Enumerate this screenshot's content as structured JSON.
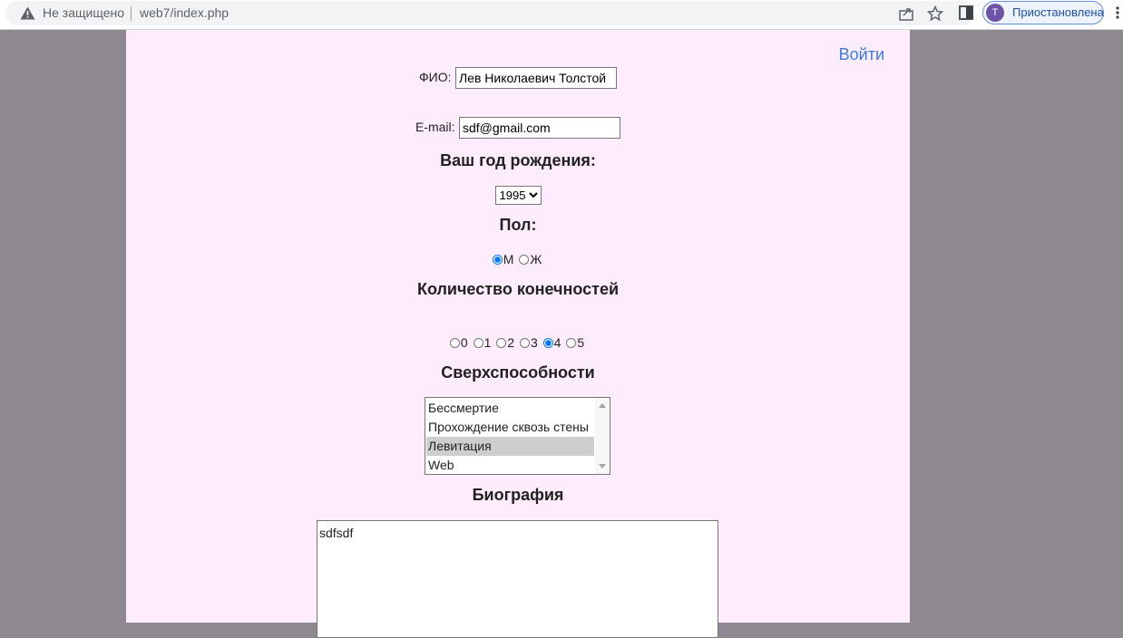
{
  "browser": {
    "security_label": "Не защищено",
    "url": "web7/index.php",
    "profile_initial": "T",
    "profile_status": "Приостановлена"
  },
  "page": {
    "login_link": "Войти",
    "fio_label": "ФИО:",
    "fio_value": "Лев Николаевич Толстой",
    "email_label": "E-mail:",
    "email_value": "sdf@gmail.com",
    "birth_year_heading": "Ваш год рождения:",
    "birth_year_selected": "1995",
    "gender_heading": "Пол:",
    "gender_options": [
      {
        "label": "М",
        "checked": true
      },
      {
        "label": "Ж",
        "checked": false
      }
    ],
    "limbs_heading": "Количество конечностей",
    "limbs_options": [
      {
        "label": "0",
        "checked": false
      },
      {
        "label": "1",
        "checked": false
      },
      {
        "label": "2",
        "checked": false
      },
      {
        "label": "3",
        "checked": false
      },
      {
        "label": "4",
        "checked": true
      },
      {
        "label": "5",
        "checked": false
      }
    ],
    "abilities_heading": "Сверхспособности",
    "abilities_options": [
      {
        "label": "Бессмертие",
        "selected": false
      },
      {
        "label": "Прохождение сквозь стены",
        "selected": false
      },
      {
        "label": "Левитация",
        "selected": true
      },
      {
        "label": "Web",
        "selected": false
      }
    ],
    "bio_heading": "Биография",
    "bio_value": "sdfsdf"
  },
  "colors": {
    "page_background": "#fdedfc",
    "outer_background": "#8e8990",
    "link": "#3b7be0",
    "radio_accent": "#1a73e8"
  }
}
